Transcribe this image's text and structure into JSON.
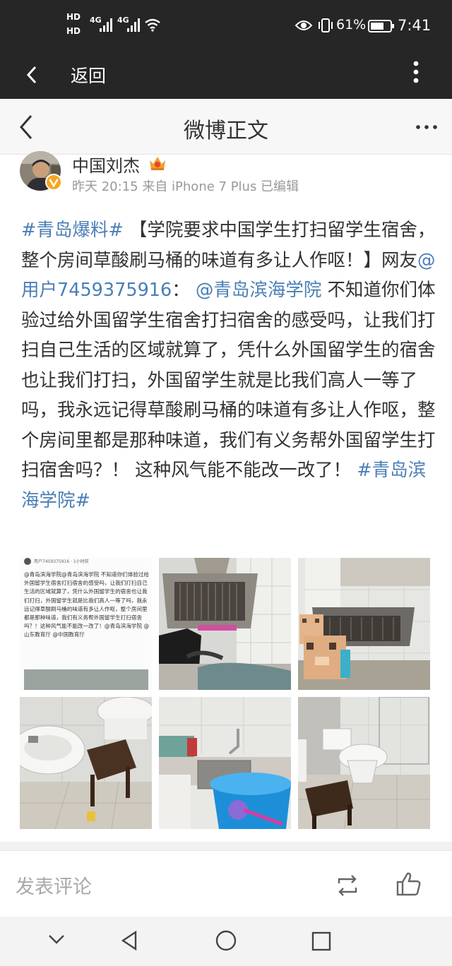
{
  "status_bar": {
    "hd1": "HD",
    "hd2": "HD",
    "net1": "4G",
    "net2": "4G",
    "battery": "61%",
    "time": "7:41"
  },
  "app_bar": {
    "back_label": "返回"
  },
  "weibo_header": {
    "title": "微博正文"
  },
  "post": {
    "author": "中国刘杰",
    "meta": "昨天 20:15 来自 iPhone 7 Plus 已编辑",
    "text_segments": {
      "hashtag1": "#青岛爆料#",
      "headline": " 【学院要求中国学生打扫留学生宿舍，整个房间草酸刷马桶的味道有多让人作呕！】网友",
      "mention_user": "@用户7459375916",
      "colon": "：",
      "mention_school": "@青岛滨海学院",
      "body": " 不知道你们体验过给外国留学生宿舍打扫宿舍的感受吗，让我们打扫自己生活的区域就算了，凭什么外国留学生的宿舍也让我们打扫，外国留学生就是比我们高人一等了吗，我永远记得草酸刷马桶的味道有多让人作呕，整个房间里都是那种味道，我们有义务帮外国留学生打扫宿舍吗？！ 这种风气能不能改一改了！ ",
      "hashtag2": "#青岛滨海学院#"
    },
    "screenshot_thumb": {
      "user": "用户7459375916 · 1小时前",
      "text": "@青岛滨海学院@青岛滨海学院 不知道你们体验过给外国留学生宿舍打扫宿舍的感受吗，让我们打扫自己生活的区域就算了，凭什么外国留学生的宿舍也让我们打扫，外国留学生就是比我们高人一等了吗，我永远记得草酸刷马桶的味道有多让人作呕，整个房间里都是那种味道，我们有义务帮外国留学生打扫宿舍吗？！这种风气能不能改一改了！@青岛滨海学院 @山东教育厅 @中国教育厅"
    }
  },
  "comment_bar": {
    "placeholder": "发表评论"
  },
  "colors": {
    "link": "#4a7eb6",
    "dark_bar": "#262626",
    "vip_badge": "#f0a030",
    "verify_badge": "#f5a623"
  }
}
